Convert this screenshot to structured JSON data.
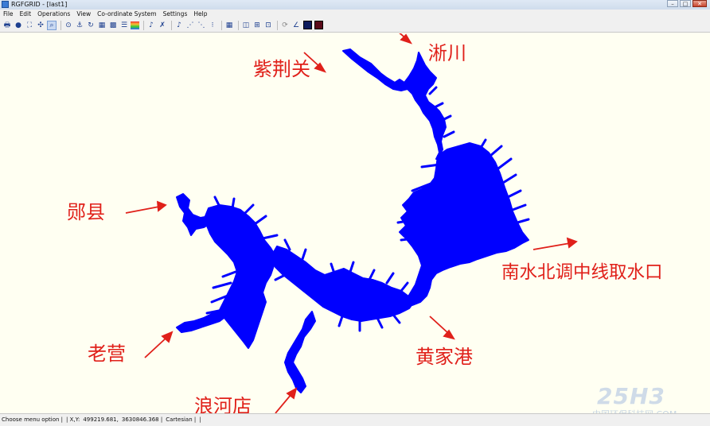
{
  "window": {
    "title": "RGFGRID - [last1]"
  },
  "menu": [
    "File",
    "Edit",
    "Operations",
    "View",
    "Co-ordinate System",
    "Settings",
    "Help"
  ],
  "toolbar_icons": [
    "print-icon",
    "globe-icon",
    "zoom-extent-icon",
    "zoom-in-icon",
    "zoom-box-icon",
    "target-icon",
    "anchor-icon",
    "refresh-icon",
    "grid-icon",
    "grid-edit-icon",
    "list-icon",
    "color-bar-icon",
    "spline-icon",
    "spline-delete-icon",
    "spline-add-icon",
    "spline-insert-icon",
    "spline-move-icon",
    "grid-refine-icon",
    "grid-select-icon",
    "grid-polygon-icon",
    "grid-delete-icon",
    "grid-link-icon",
    "curve-icon",
    "angle-icon",
    "color-square-icon",
    "color-square-red-icon"
  ],
  "status": {
    "message": "Choose menu option |",
    "coords_label": "| X,Y:",
    "x": "499219.681,",
    "y": "3630846.368 |",
    "system": "Cartesian |",
    "tail": "|"
  },
  "labels": {
    "zijingguan": "紫荆关",
    "xichuan": "淅川",
    "yunxian": "郧县",
    "nanshui": "南水北调中线取水口",
    "laoying": "老营",
    "huangjiagang": "黄家港",
    "langhedian": "浪河店"
  },
  "watermark": {
    "logo": "25H3",
    "text": "中国环保科技网·COM"
  },
  "colors": {
    "reservoir": "#0000ff",
    "annotation": "#e0201a",
    "canvas": "#fffff2"
  }
}
